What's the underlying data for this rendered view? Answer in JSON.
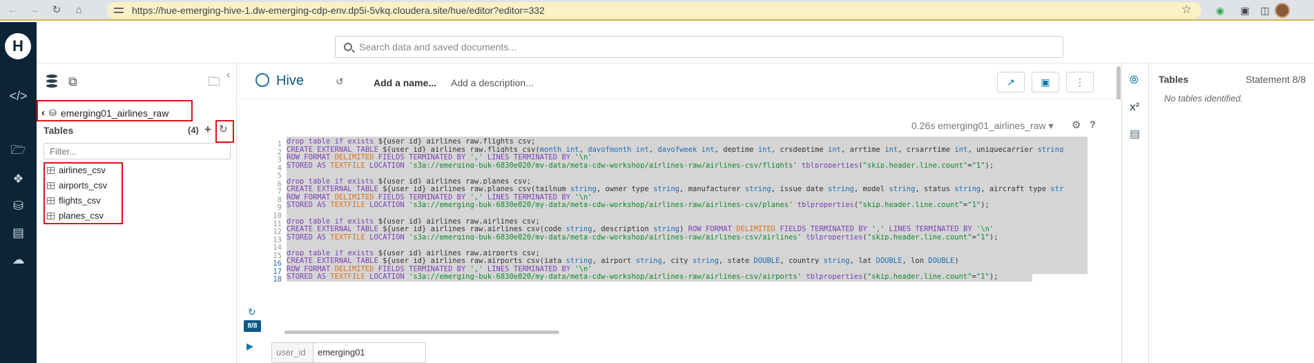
{
  "browser": {
    "url": "https://hue-emerging-hive-1.dw-emerging-cdp-env.dp5i-5vkq.cloudera.site/hue/editor?editor=332"
  },
  "search": {
    "placeholder": "Search data and saved documents..."
  },
  "assist": {
    "database": "emerging01_airlines_raw",
    "tables_label": "Tables",
    "tables_count": "(4)",
    "filter_placeholder": "Filter...",
    "tables": [
      "airlines_csv",
      "airports_csv",
      "flights_csv",
      "planes_csv"
    ]
  },
  "editor": {
    "dialect": "Hive",
    "add_name": "Add a name...",
    "add_description": "Add a description...",
    "exec_info": "0.26s emerging01_airlines_raw",
    "statement_badge": "8/8",
    "code_lines": [
      "drop table if exists ${user_id}_airlines_raw.flights_csv;",
      "CREATE EXTERNAL TABLE ${user_id}_airlines_raw.flights_csv(month int, dayofmonth int, dayofweek int, deptime int, crsdeptime int, arrtime int, crsarrtime int, uniquecarrier string",
      "ROW FORMAT DELIMITED FIELDS TERMINATED BY ',' LINES TERMINATED BY '\\n'",
      "STORED AS TEXTFILE LOCATION 's3a://emerging-buk-6830e020/my-data/meta-cdw-workshop/airlines-raw/airlines-csv/flights' tblproperties(\"skip.header.line.count\"=\"1\");",
      "",
      "drop table if exists ${user_id}_airlines_raw.planes_csv;",
      "CREATE EXTERNAL TABLE ${user_id}_airlines_raw.planes_csv(tailnum string, owner_type string, manufacturer string, issue_date string, model string, status string, aircraft_type str",
      "ROW FORMAT DELIMITED FIELDS TERMINATED BY ',' LINES TERMINATED BY '\\n'",
      "STORED AS TEXTFILE LOCATION 's3a://emerging-buk-6830e020/my-data/meta-cdw-workshop/airlines-raw/airlines-csv/planes' tblproperties(\"skip.header.line.count\"=\"1\");",
      "",
      "drop table if exists ${user_id}_airlines_raw.airlines_csv;",
      "CREATE EXTERNAL TABLE ${user_id}_airlines_raw.airlines_csv(code string, description string) ROW FORMAT DELIMITED FIELDS TERMINATED BY ',' LINES TERMINATED BY '\\n'",
      "STORED AS TEXTFILE LOCATION 's3a://emerging-buk-6830e020/my-data/meta-cdw-workshop/airlines-raw/airlines-csv/airlines' tblproperties(\"skip.header.line.count\"=\"1\");",
      "",
      "drop table if exists ${user_id}_airlines_raw.airports_csv;",
      "CREATE EXTERNAL TABLE ${user_id}_airlines_raw.airports_csv(iata string, airport string, city string, state DOUBLE, country string, lat DOUBLE, lon DOUBLE)",
      "ROW FORMAT DELIMITED FIELDS TERMINATED BY ',' LINES TERMINATED BY '\\n'",
      "STORED AS TEXTFILE LOCATION 's3a://emerging-buk-6830e020/my-data/meta-cdw-workshop/airlines-raw/airlines-csv/airports' tblproperties(\"skip.header.line.count\"=\"1\");"
    ],
    "parameter": {
      "label": "user_id",
      "value": "emerging01"
    }
  },
  "right_panel": {
    "title": "Tables",
    "statement": "Statement 8/8",
    "note": "No tables identified."
  },
  "colors": {
    "nav_bg": "#0b2536",
    "accent": "#0a78a6",
    "highlight_box": "#e0101b",
    "selection_bg": "#d5d5d5"
  }
}
